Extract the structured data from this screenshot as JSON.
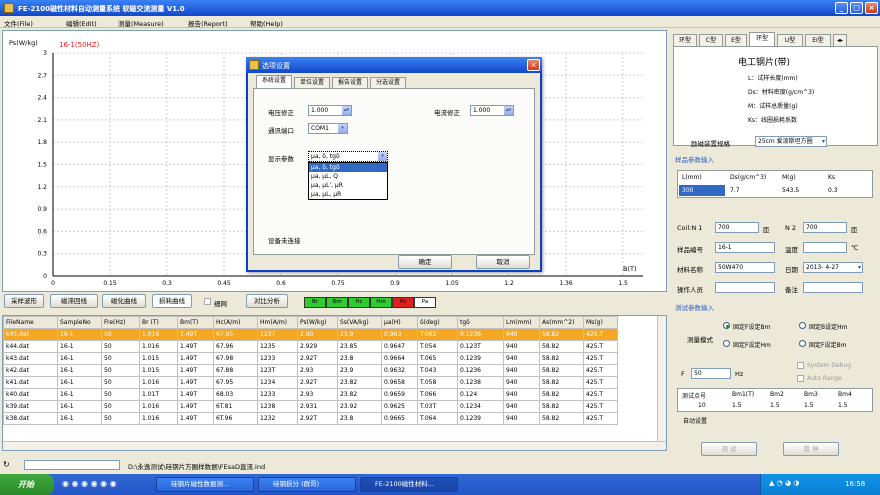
{
  "window": {
    "title": "FE-2100磁性材料自动测量系统 软磁交流测量 V1.0"
  },
  "menu": [
    "文件(File)",
    "编辑(Edit)",
    "测量(Measure)",
    "报告(Report)",
    "帮助(Help)"
  ],
  "graph": {
    "ylabel": "Ps(W/kg)",
    "legend": "16-1(50HZ)",
    "xlabel": "B(T)",
    "y_ticks": [
      "3",
      "2.7",
      "2.4",
      "2.1",
      "1.8",
      "1.5",
      "1.2",
      "0.9",
      "0.6",
      "0.3",
      "0"
    ],
    "x_ticks": [
      "0",
      "0.15",
      "0.3",
      "0.45",
      "0.6",
      "0.75",
      "0.9",
      "1.05",
      "1.2",
      "1.36",
      "1.5"
    ]
  },
  "toolbar2": {
    "btn1": "采样波形",
    "btn2": "磁滞回线",
    "btn3": "磁化曲线",
    "btn4": "损耗曲线",
    "checkbox": "细网",
    "btn5": "对比分析",
    "indicators": [
      "Br",
      "Bm",
      "Hc",
      "Hm",
      "Ps",
      "Pa"
    ],
    "indicator_colors": [
      "#2ecc2e",
      "#2ecc2e",
      "#2ecc2e",
      "#2ecc2e",
      "#e02020",
      "#ffffff"
    ]
  },
  "grid": {
    "headers": [
      "FileName",
      "SampleNo",
      "Fre(Hz)",
      "Br (T)",
      "Bm(T)",
      "Hc(A/m)",
      "Hm(A/m)",
      "Ps(W/kg)",
      "Ss(VA/kg)",
      "μa(H)",
      "δ(deg)",
      "tgδ",
      "Lm(mm)",
      "As(mm^2)",
      "Ms(g)"
    ],
    "rows": [
      [
        "k45.dat",
        "16-1",
        "50",
        "1.016",
        "1.49T",
        "67.95",
        "1237",
        "2.90",
        "23.9",
        "0.963",
        "T.062",
        "0.1236",
        "940",
        "58.82",
        "425.T"
      ],
      [
        "k44.dat",
        "16-1",
        "50",
        "1.016",
        "1.49T",
        "67.96",
        "1235",
        "2.929",
        "23.85",
        "0.9647",
        "T.054",
        "0.123T",
        "940",
        "58.82",
        "425.T"
      ],
      [
        "k43.dat",
        "16-1",
        "50",
        "1.015",
        "1.49T",
        "67.98",
        "1233",
        "2.92T",
        "23.8",
        "0.9664",
        "T.065",
        "0.1239",
        "940",
        "58.82",
        "425.T"
      ],
      [
        "k42.dat",
        "16-1",
        "50",
        "1.015",
        "1.49T",
        "67.88",
        "123T",
        "2.93",
        "23.9",
        "0.9632",
        "T.043",
        "0.1236",
        "940",
        "58.82",
        "425.T"
      ],
      [
        "k41.dat",
        "16-1",
        "50",
        "1.016",
        "1.49T",
        "67.95",
        "1234",
        "2.92T",
        "23.82",
        "0.9658",
        "T.058",
        "0.1238",
        "940",
        "58.82",
        "425.T"
      ],
      [
        "k40.dat",
        "16-1",
        "50",
        "1.01T",
        "1.49T",
        "68.03",
        "1233",
        "2.93",
        "23.82",
        "0.9659",
        "T.066",
        "0.124",
        "940",
        "58.82",
        "425.T"
      ],
      [
        "k39.dat",
        "16-1",
        "50",
        "1.016",
        "1.49T",
        "6T.81",
        "1238",
        "2.931",
        "23.92",
        "0.9625",
        "T.03T",
        "0.1234",
        "940",
        "58.82",
        "425.T"
      ],
      [
        "k38.dat",
        "16-1",
        "50",
        "1.016",
        "1.49T",
        "6T.96",
        "1232",
        "2.92T",
        "23.8",
        "0.9665",
        "T.064",
        "0.1239",
        "940",
        "58.82",
        "425.T"
      ]
    ]
  },
  "statusbar": {
    "path": "D:\\永逸测试\\硅钢片方圈样数据\\FEsaD直流.ind"
  },
  "right": {
    "tabs": [
      "环型",
      "C型",
      "E型",
      "环型",
      "U型",
      "EI型"
    ],
    "pane_title": "电工钢片(带)",
    "desc": [
      "L：试样长度(mm)",
      "Ds：材料密度(g/cm^3)",
      "M：试样总质量(g)",
      "Ks：线圈损耗系数"
    ],
    "dev_label": "励磁装置规格",
    "dev_value": "25cm 爱泼斯坦方圈",
    "param_hdr": "样品参数输入",
    "param_headers": [
      "L(mm)",
      "Ds(g/cm^3)",
      "M(g)",
      "Ks"
    ],
    "param_values": [
      "300",
      "7.7",
      "543.5",
      "0.3"
    ],
    "coil_n1_label": "Coil:N 1",
    "coil_n1": "700",
    "coil_n1_unit": "匝",
    "n2_label": "N 2",
    "n2": "700",
    "n2_unit": "匝",
    "sample_no_label": "样品编号",
    "sample_no": "16-1",
    "temp_label": "温度",
    "temp_unit": "℃",
    "material_label": "材料名称",
    "material": "50W470",
    "date_label": "日期",
    "date": "2013- 4-27",
    "operator_label": "操作人员",
    "remark_label": "备注",
    "test_hdr": "测试参数输入",
    "mode_label": "测量模式",
    "radios": [
      "固定F设定Bm",
      "固定B设定Hm",
      "固定F设定Hm",
      "固定F设定Bm"
    ],
    "sys_debug": "System Debug",
    "auto_range": "Auto Range",
    "f_label": "F",
    "f_value": "50",
    "f_unit": "Hz",
    "meas_headers": [
      "测试点号",
      "Bm1(T)",
      "Bm2",
      "Bm3",
      "Bm4"
    ],
    "meas_values": [
      "10",
      "1.5",
      "1.5",
      "1.5",
      "1.5"
    ],
    "auto_label": "自动设置",
    "btn_test": "测 试",
    "btn_stop": "暂 停"
  },
  "dialog": {
    "title": "选项设置",
    "tabs": [
      "系统设置",
      "单位设置",
      "报告设置",
      "分选设置"
    ],
    "voltage_label": "电压修正",
    "voltage_value": "1.000",
    "current_label": "电流修正",
    "current_value": "1.000",
    "port_label": "通讯端口",
    "port_value": "COM1",
    "display_label": "显示参数",
    "display_value": "μa, δ, tgδ",
    "display_options": [
      "μa, δ, tgδ",
      "μa, μL, Q",
      "μa, μL', μR",
      "μa, μL, μR"
    ],
    "device_status": "设备未连接",
    "ok": "确定",
    "cancel": "取消"
  },
  "taskbar": {
    "start": "开始",
    "tasks": [
      "硅钢片磁性数据测...",
      "硅钢损分 (群哥)",
      "FE-2100磁性材料..."
    ],
    "clock": "16:58"
  }
}
